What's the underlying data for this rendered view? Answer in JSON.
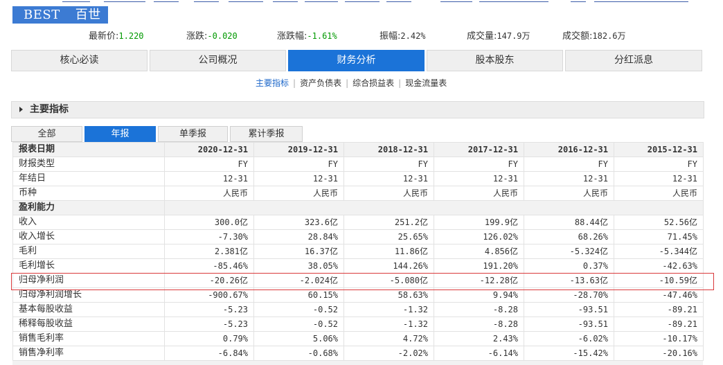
{
  "stock": {
    "symbol": "BEST",
    "name": "百世"
  },
  "quote": {
    "last_price_label": "最新价:",
    "last_price": "1.220",
    "change_label": "涨跌:",
    "change": "-0.020",
    "change_pct_label": "涨跌幅:",
    "change_pct": "-1.61%",
    "amplitude_label": "振幅:",
    "amplitude": "2.42%",
    "volume_label": "成交量:",
    "volume": "147.9万",
    "turnover_label": "成交额:",
    "turnover": "182.6万"
  },
  "main_tabs": [
    "核心必读",
    "公司概况",
    "财务分析",
    "股本股东",
    "分红派息"
  ],
  "sub_links": [
    "主要指标",
    "资产负债表",
    "综合损益表",
    "现金流量表"
  ],
  "section_title": "主要指标",
  "period_tabs": [
    "全部",
    "年报",
    "单季报",
    "累计季报"
  ],
  "table": {
    "header_label": "报表日期",
    "columns": [
      "2020-12-31",
      "2019-12-31",
      "2018-12-31",
      "2017-12-31",
      "2016-12-31",
      "2015-12-31"
    ],
    "rows": [
      {
        "label": "财报类型",
        "values": [
          "FY",
          "FY",
          "FY",
          "FY",
          "FY",
          "FY"
        ]
      },
      {
        "label": "年结日",
        "values": [
          "12-31",
          "12-31",
          "12-31",
          "12-31",
          "12-31",
          "12-31"
        ]
      },
      {
        "label": "币种",
        "values": [
          "人民币",
          "人民币",
          "人民币",
          "人民币",
          "人民币",
          "人民币"
        ]
      },
      {
        "section": "盈利能力"
      },
      {
        "label": "收入",
        "values": [
          "300.0亿",
          "323.6亿",
          "251.2亿",
          "199.9亿",
          "88.44亿",
          "52.56亿"
        ]
      },
      {
        "label": "收入增长",
        "values": [
          "-7.30%",
          "28.84%",
          "25.65%",
          "126.02%",
          "68.26%",
          "71.45%"
        ]
      },
      {
        "label": "毛利",
        "values": [
          "2.381亿",
          "16.37亿",
          "11.86亿",
          "4.856亿",
          "-5.324亿",
          "-5.344亿"
        ]
      },
      {
        "label": "毛利增长",
        "values": [
          "-85.46%",
          "38.05%",
          "144.26%",
          "191.20%",
          "0.37%",
          "-42.63%"
        ]
      },
      {
        "label": "归母净利润",
        "values": [
          "-20.26亿",
          "-2.024亿",
          "-5.080亿",
          "-12.28亿",
          "-13.63亿",
          "-10.59亿"
        ]
      },
      {
        "label": "归母净利润增长",
        "values": [
          "-900.67%",
          "60.15%",
          "58.63%",
          "9.94%",
          "-28.70%",
          "-47.46%"
        ]
      },
      {
        "label": "基本每股收益",
        "values": [
          "-5.23",
          "-0.52",
          "-1.32",
          "-8.28",
          "-93.51",
          "-89.21"
        ]
      },
      {
        "label": "稀释每股收益",
        "values": [
          "-5.23",
          "-0.52",
          "-1.32",
          "-8.28",
          "-93.51",
          "-89.21"
        ]
      },
      {
        "label": "销售毛利率",
        "values": [
          "0.79%",
          "5.06%",
          "4.72%",
          "2.43%",
          "-6.02%",
          "-10.17%"
        ]
      },
      {
        "label": "销售净利率",
        "values": [
          "-6.84%",
          "-0.68%",
          "-2.02%",
          "-6.14%",
          "-15.42%",
          "-20.16%"
        ]
      }
    ]
  },
  "colors": {
    "accent": "#1b73d8",
    "title_bg": "#3c7bd3",
    "positive": "#009900",
    "highlight": "#d9383a"
  }
}
